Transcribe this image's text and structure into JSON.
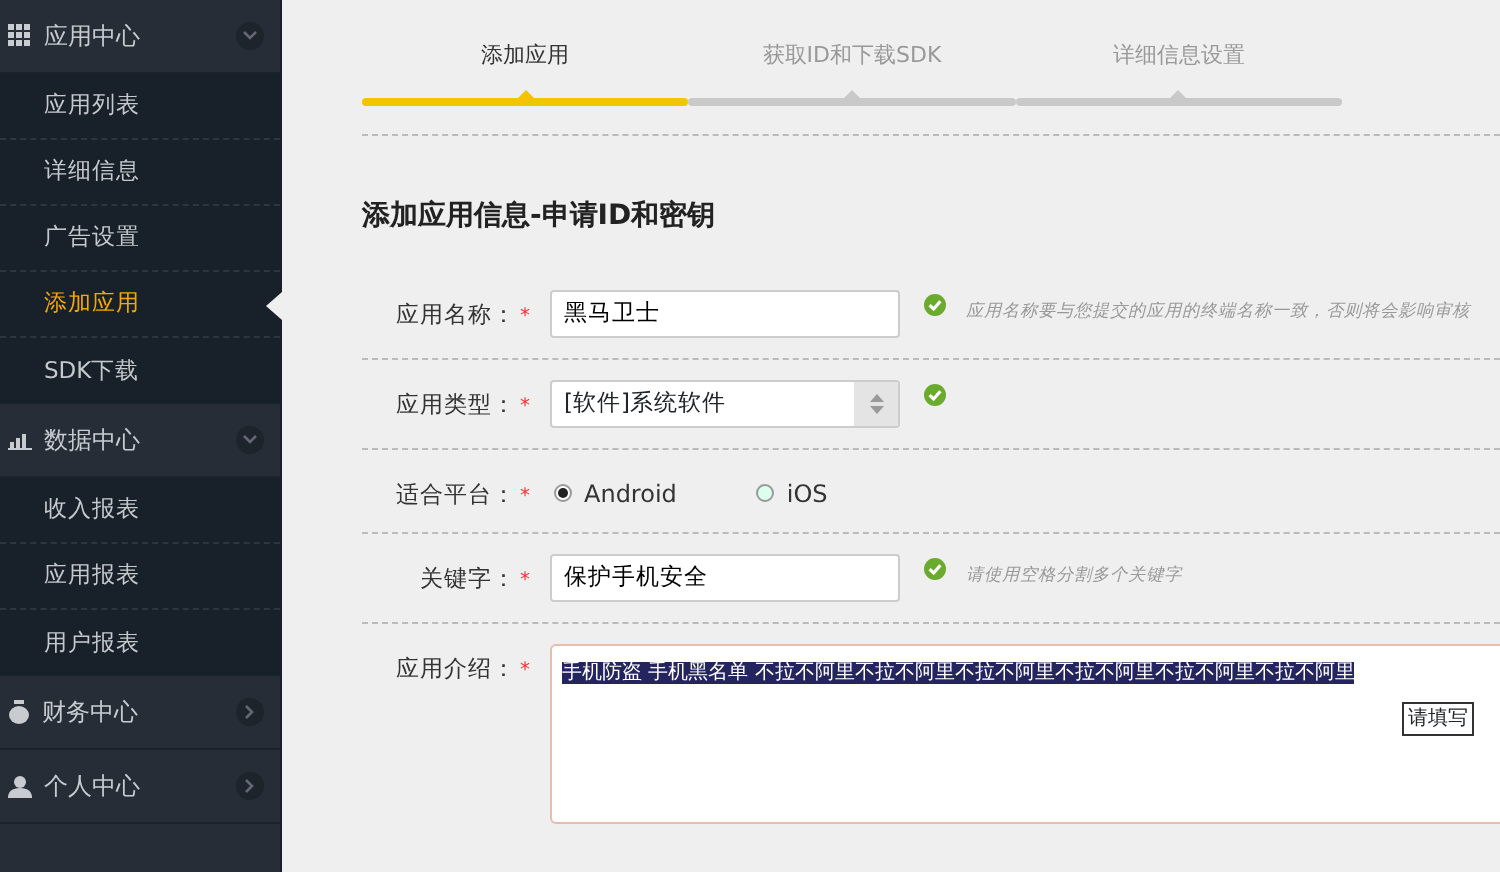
{
  "sidebar": {
    "groups": [
      {
        "title": "应用中心",
        "expanded": true,
        "children": [
          {
            "label": "应用列表",
            "selected": false
          },
          {
            "label": "详细信息",
            "selected": false
          },
          {
            "label": "广告设置",
            "selected": false
          },
          {
            "label": "添加应用",
            "selected": true
          },
          {
            "label": "SDK下载",
            "selected": false
          }
        ]
      },
      {
        "title": "数据中心",
        "expanded": true,
        "children": [
          {
            "label": "收入报表",
            "selected": false
          },
          {
            "label": "应用报表",
            "selected": false
          },
          {
            "label": "用户报表",
            "selected": false
          }
        ]
      },
      {
        "title": "财务中心",
        "expanded": false
      },
      {
        "title": "个人中心",
        "expanded": false
      }
    ]
  },
  "steps": [
    {
      "label": "添加应用",
      "selected": true
    },
    {
      "label": "获取ID和下载SDK",
      "selected": false
    },
    {
      "label": "详细信息设置",
      "selected": false
    }
  ],
  "heading": "添加应用信息-申请ID和密钥",
  "form": [
    {
      "kind": "text",
      "label": "应用名称：",
      "required": "*",
      "value": "黑马卫士",
      "valid": true,
      "hint": "应用名称要与您提交的应用的终端名称一致，否则将会影响审核"
    },
    {
      "kind": "select",
      "label": "应用类型：",
      "required": "*",
      "value": "[软件]系统软件",
      "valid": true
    },
    {
      "kind": "radio",
      "label": "适合平台：",
      "required": "*",
      "options": [
        {
          "label": "Android",
          "selected": true
        },
        {
          "label": "iOS",
          "selected": false
        }
      ]
    },
    {
      "kind": "text",
      "label": "关键字：",
      "required": "*",
      "value": "保护手机安全",
      "valid": true,
      "hint": "请使用空格分割多个关键字"
    },
    {
      "kind": "textarea",
      "label": "应用介绍：",
      "required": "*",
      "value": "手机防盗 手机黑名单 不拉不阿里不拉不阿里不拉不阿里不拉不阿里不拉不阿里不拉不阿里",
      "tooltip": "请填写"
    }
  ]
}
